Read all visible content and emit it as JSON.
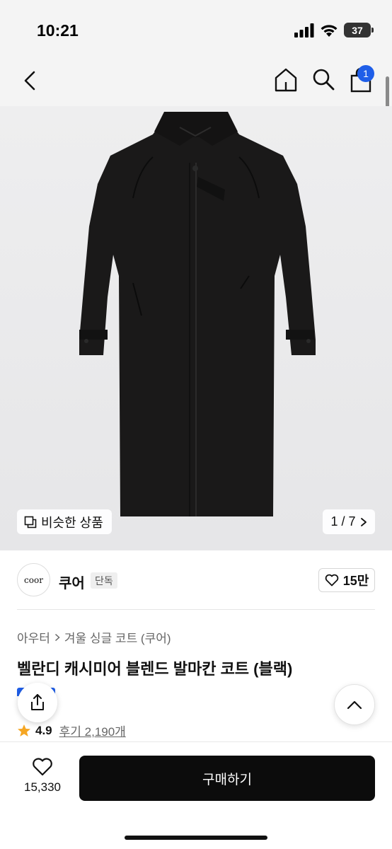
{
  "status": {
    "time": "10:21",
    "battery": "37"
  },
  "nav": {
    "cart_count": "1"
  },
  "gallery": {
    "similar_label": "비슷한 상품",
    "pager": "1 / 7"
  },
  "brand": {
    "logo_text": "coor",
    "name": "쿠어",
    "badge": "단독",
    "likes": "15만"
  },
  "product": {
    "breadcrumb": [
      "아우터",
      "겨울 싱글 코트 (쿠어)"
    ],
    "title": "벨란디 캐시미어 블렌드 발마칸 코트 (블랙)",
    "rating": "4.9",
    "reviews": "후기 2,190개"
  },
  "footer": {
    "wish_count": "15,330",
    "buy_label": "구매하기"
  },
  "colors": {
    "accent": "#1f5ee8",
    "buy_button": "#0c0c0c",
    "star": "#f5a623"
  }
}
